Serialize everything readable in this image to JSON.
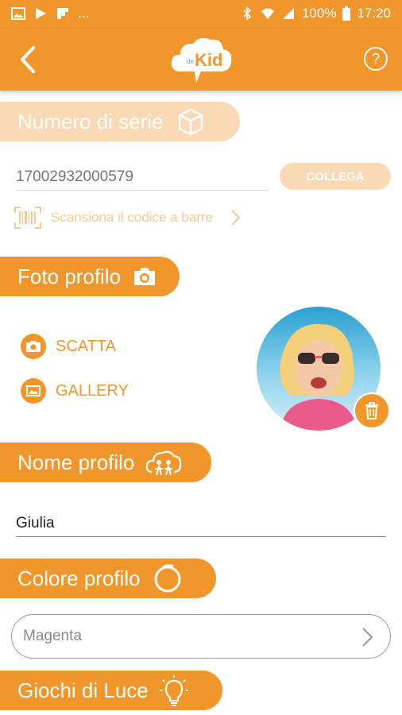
{
  "statusbar": {
    "notification_icons": [
      "image-icon",
      "play-store-icon",
      "flipboard-icon"
    ],
    "ellipsis": "...",
    "battery": "100%",
    "time": "17:20"
  },
  "appbar": {
    "logo_small": "de",
    "logo_text": "Kid",
    "help_label": "?"
  },
  "serial_section": {
    "title": "Numero di serie",
    "icon": "box-icon",
    "input_placeholder": "17002932000579",
    "connect_label": "COLLEGA",
    "scan_label": "Scansiona il codice a barre"
  },
  "photo_section": {
    "title": "Foto profilo",
    "icon": "camera-icon",
    "take_label": "SCATTA",
    "gallery_label": "GALLERY"
  },
  "name_section": {
    "title": "Nome profilo",
    "icon": "kids-cloud-icon",
    "value": "Giulia"
  },
  "color_section": {
    "title": "Colore profilo",
    "icon": "ring-icon",
    "selected": "Magenta"
  },
  "lights_section": {
    "title": "Giochi di Luce",
    "icon": "lightbulb-icon"
  },
  "colors": {
    "accent": "#f0962a",
    "accent_faded": "#fbd9b4"
  }
}
